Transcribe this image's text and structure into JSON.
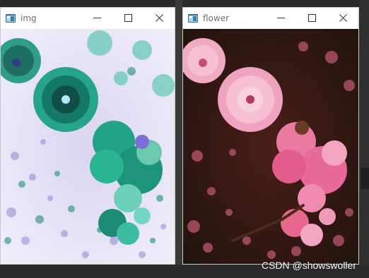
{
  "windows": [
    {
      "title": "img",
      "icon": "window-app-icon",
      "controls": {
        "minimize": "minimize-icon",
        "maximize": "maximize-icon",
        "close": "close-icon"
      }
    },
    {
      "title": "flower",
      "icon": "window-app-icon",
      "controls": {
        "minimize": "minimize-icon",
        "maximize": "maximize-icon",
        "close": "close-icon"
      }
    }
  ],
  "watermark": "CSDN @showswoller",
  "colors": {
    "desktop": "#2b2b2b",
    "titlebar": "#ffffff",
    "inverted_bg": "#e9e7f7",
    "inverted_flower": "#1aa48a",
    "flower_pink": "#e86a9b",
    "flower_dark": "#5a2a1f"
  }
}
